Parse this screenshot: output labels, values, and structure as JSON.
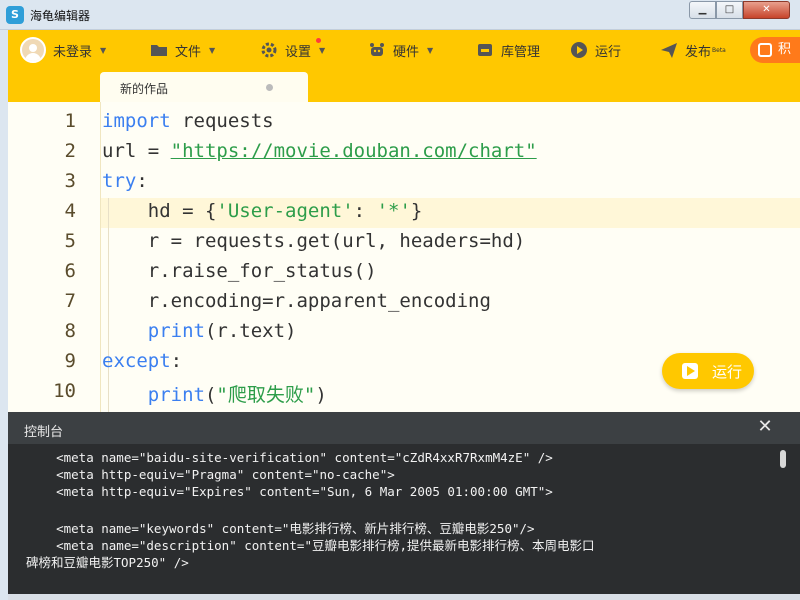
{
  "window": {
    "title": "海龟编辑器",
    "logo_glyph": "S",
    "minimize": "▁",
    "maximize": "□",
    "close": "✕"
  },
  "toolbar": {
    "user": "未登录",
    "file": "文件",
    "settings": "设置",
    "hardware": "硬件",
    "library": "库管理",
    "run": "运行",
    "publish": "发布",
    "publish_badge": "Beta",
    "extra": "积"
  },
  "tab": {
    "label": "新的作品"
  },
  "editor": {
    "line_numbers": [
      "1",
      "2",
      "3",
      "4",
      "5",
      "6",
      "7",
      "8",
      "9",
      "10"
    ],
    "lines": [
      [
        "import",
        " requests"
      ],
      [
        "url = ",
        "\"https://movie.douban.com/chart\""
      ],
      [
        "try",
        ":"
      ],
      [
        "    hd = {",
        "'User-agent'",
        ": ",
        "'*'",
        "}"
      ],
      [
        "    r = requests.get(url, headers=hd)"
      ],
      [
        "    r.raise_for_status()"
      ],
      [
        "    r.encoding=r.apparent_encoding"
      ],
      [
        "    ",
        "print",
        "(r.text)"
      ],
      [
        "except",
        ":"
      ],
      [
        "    ",
        "print",
        "(",
        "\"爬取失败\"",
        ")"
      ]
    ],
    "run_button": "运行"
  },
  "console": {
    "title": "控制台",
    "close": "✕",
    "lines": [
      "    <meta name=\"baidu-site-verification\" content=\"cZdR4xxR7RxmM4zE\" />",
      "    <meta http-equiv=\"Pragma\" content=\"no-cache\">",
      "    <meta http-equiv=\"Expires\" content=\"Sun, 6 Mar 2005 01:00:00 GMT\">",
      "",
      "    <meta name=\"keywords\" content=\"电影排行榜、新片排行榜、豆瓣电影250\"/>",
      "    <meta name=\"description\" content=\"豆瓣电影排行榜,提供最新电影排行榜、本周电影口",
      "碑榜和豆瓣电影TOP250\" />"
    ]
  },
  "colors": {
    "accent": "#ffc800",
    "keyword": "#3b7ff0",
    "string": "#2d9d4a",
    "console_bg": "#2b2d2f"
  }
}
